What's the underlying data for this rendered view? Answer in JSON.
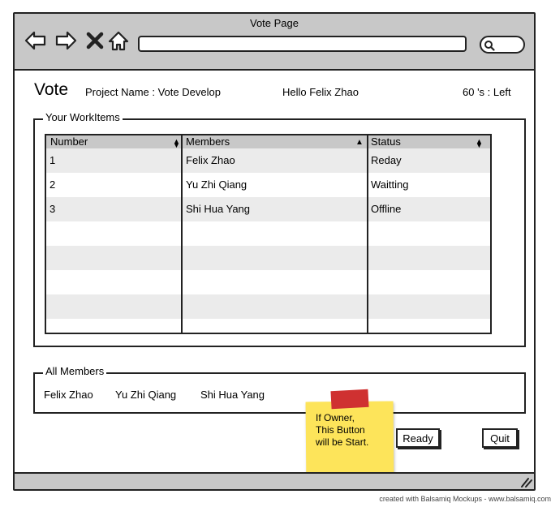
{
  "window": {
    "title": "Vote Page"
  },
  "header": {
    "title": "Vote",
    "project": "Project Name : Vote Develop",
    "greeting": "Hello Felix Zhao",
    "timer": "60 's : Left"
  },
  "workitems": {
    "legend": "Your WorkItems",
    "columns": [
      "Number",
      "Members",
      "Status"
    ],
    "rows": [
      [
        "1",
        "Felix Zhao",
        "Reday"
      ],
      [
        "2",
        "Yu Zhi Qiang",
        "Waitting"
      ],
      [
        "3",
        "Shi Hua Yang",
        "Offline"
      ]
    ]
  },
  "members": {
    "legend": "All Members",
    "names": [
      "Felix Zhao",
      "Yu Zhi Qiang",
      "Shi Hua Yang"
    ]
  },
  "sticky_note": {
    "text": "If Owner,\nThis Button\nwill be Start."
  },
  "actions": {
    "ready": "Ready",
    "quit": "Quit"
  },
  "footer": {
    "credit": "created with Balsamiq Mockups - www.balsamiq.com"
  },
  "icons": [
    "back-arrow-icon",
    "forward-arrow-icon",
    "close-x-icon",
    "home-icon",
    "search-icon",
    "resize-grip-icon"
  ]
}
